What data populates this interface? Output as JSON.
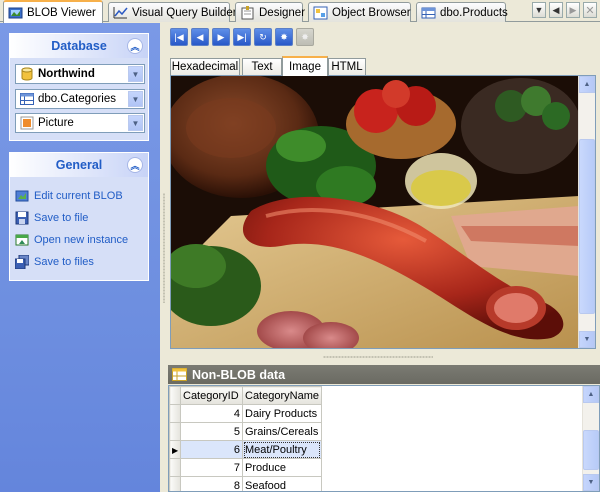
{
  "tabs": [
    {
      "label": "BLOB Viewer",
      "active": true
    },
    {
      "label": "Visual Query Builder",
      "active": false
    },
    {
      "label": "Designer",
      "active": false
    },
    {
      "label": "Object Browser",
      "active": false
    },
    {
      "label": "dbo.Products",
      "active": false
    }
  ],
  "database_group": {
    "title": "Database",
    "database": "Northwind",
    "table": "dbo.Categories",
    "column": "Picture"
  },
  "general_group": {
    "title": "General",
    "items": [
      {
        "label": "Edit current BLOB",
        "icon": "edit-blob-icon"
      },
      {
        "label": "Save to file",
        "icon": "floppy-icon"
      },
      {
        "label": "Open new instance",
        "icon": "new-window-icon"
      },
      {
        "label": "Save to files",
        "icon": "floppies-icon"
      }
    ]
  },
  "toolbar": {
    "buttons": [
      "first-record",
      "prior-record",
      "next-record",
      "last-record",
      "refresh",
      "apply",
      "cancel"
    ]
  },
  "view_tabs": [
    {
      "label": "Hexadecimal",
      "active": false
    },
    {
      "label": "Text",
      "active": false
    },
    {
      "label": "Image",
      "active": true
    },
    {
      "label": "HTML",
      "active": false
    }
  ],
  "non_blob": {
    "title": "Non-BLOB data",
    "columns": [
      "CategoryID",
      "CategoryName"
    ],
    "rows": [
      {
        "id": "4",
        "name": "Dairy Products",
        "selected": false
      },
      {
        "id": "5",
        "name": "Grains/Cereals",
        "selected": false
      },
      {
        "id": "6",
        "name": "Meat/Poultry",
        "selected": true
      },
      {
        "id": "7",
        "name": "Produce",
        "selected": false
      },
      {
        "id": "8",
        "name": "Seafood",
        "selected": false
      }
    ]
  },
  "colors": {
    "accent": "#215dc6",
    "panel": "#6e8fe0",
    "tab_highlight": "#f7b04a"
  }
}
